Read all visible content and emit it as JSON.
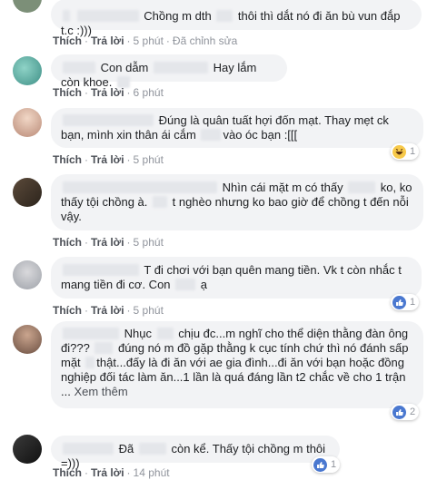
{
  "actions": {
    "like": "Thích",
    "reply": "Trả lời",
    "edited": "Đã chỉnh sửa",
    "see_more": "Xem thêm"
  },
  "comments": [
    {
      "text": "Chồng m dth thôi thì dắt nó đi ăn bù vun đắp t.c :)))",
      "time": "5 phút",
      "edited": true
    },
    {
      "text": "Con dẫm Hay lắm còn khoe.",
      "time": "6 phút"
    },
    {
      "text": "Đúng là quân tuất hợi đốn mạt. Thay mẹt ck bạn, mình xin thân ái cắm vào óc bạn :[[[",
      "time": "5 phút",
      "reaction": {
        "type": "haha",
        "count": "1"
      }
    },
    {
      "text": "Nhìn cái mặt m có thấy ko, ko thấy tội chồng à. t nghèo nhưng ko bao giờ để chồng t đến nỗi vậy.",
      "time": "5 phút"
    },
    {
      "text": "T đi chơi với bạn quên mang tiền. Vk t còn nhắc t mang tiền đi cơ. Con ạ",
      "time": "5 phút",
      "reaction": {
        "type": "like",
        "count": "1"
      }
    },
    {
      "text": "Nhục chịu đc...m nghĩ cho thể diện thằng đàn ông đi??? đúng nó m đồ gặp thằng k cục tính chứ thì nó đánh sấp mặt thật...đấy là đi ăn với ae gia đình...đi ăn với bạn hoặc đồng nghiệp đối tác làm ăn...1 lần là quá đáng lần t2 chắc về cho 1 trận",
      "time": "5 phút",
      "reaction": {
        "type": "like",
        "count": "2"
      }
    },
    {
      "text": "Đã còn kể. Thấy tội chồng m thôi =)))",
      "time": "14 phút",
      "reaction": {
        "type": "like",
        "count": "1"
      }
    }
  ],
  "colors": {
    "bubble": "#f2f3f5",
    "link": "#4b4f56",
    "meta": "#90949c",
    "like": "#4a78d0"
  }
}
